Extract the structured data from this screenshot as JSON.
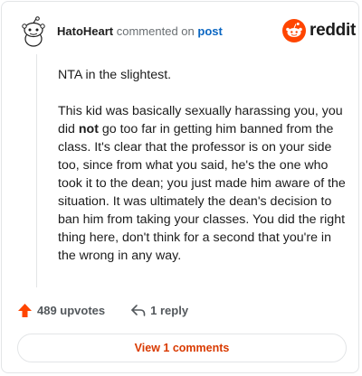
{
  "header": {
    "author": "HatoHeart",
    "verb": "commented on",
    "link": "post",
    "brand": "reddit"
  },
  "comment": {
    "line1": "NTA in the slightest.",
    "p2_before": "This kid was basically sexually harassing you, you did ",
    "p2_bold": "not",
    "p2_after": " go too far in getting him banned from the class. It's clear that the professor is on your side too, since from what you said, he's the one who took it to the dean; you just made him aware of the situation. It was ultimately the dean's decision to ban him from taking your classes. You did the right thing here, don't think for a second that you're in the wrong in any way."
  },
  "actions": {
    "upvotes": "489 upvotes",
    "reply": "1 reply"
  },
  "footer": {
    "view_comments": "View 1 comments"
  },
  "colors": {
    "accent": "#ff4500",
    "link": "#0a66c2",
    "view_text": "#d93a00"
  }
}
